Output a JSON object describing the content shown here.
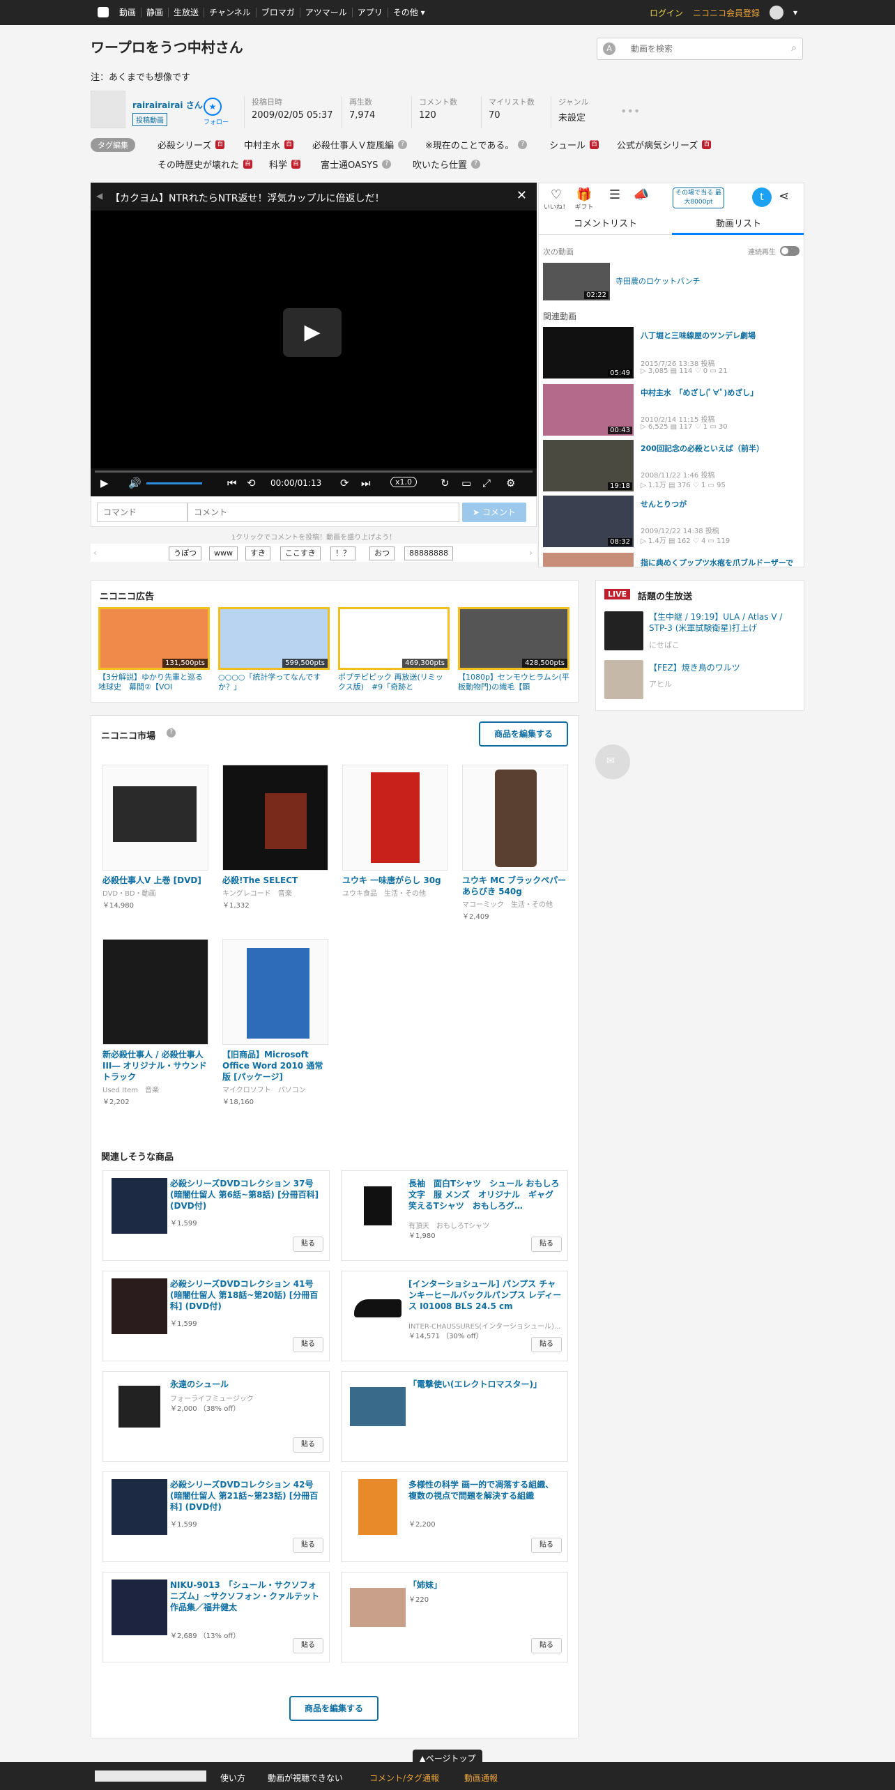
{
  "topnav": {
    "items": [
      "動画",
      "静画",
      "生放送",
      "チャンネル",
      "ブロマガ",
      "アツマール",
      "アプリ",
      "その他"
    ],
    "login": "ログイン",
    "register": "ニコニコ会員登録"
  },
  "header": {
    "title": "ワープロをうつ中村さん",
    "subtitle": "注：あくまでも想像です",
    "search_placeholder": "動画を検索"
  },
  "uploader": {
    "name": "rairairairai さん",
    "badge": "投稿動画",
    "follow": "フォロー"
  },
  "stats": [
    {
      "k": "投稿日時",
      "v": "2009/02/05 05:37"
    },
    {
      "k": "再生数",
      "v": "7,974"
    },
    {
      "k": "コメント数",
      "v": "120"
    },
    {
      "k": "マイリスト数",
      "v": "70"
    },
    {
      "k": "ジャンル",
      "v": "未設定"
    }
  ],
  "tags": {
    "edit_label": "タグ編集",
    "items": [
      "必殺シリーズ",
      "中村主水",
      "必殺仕事人Ｖ旋風編",
      "※現在のことである。",
      "シュール",
      "公式が病気シリーズ",
      "その時歴史が壊れた",
      "科学",
      "富士通OASYS",
      "吹いたら仕置"
    ]
  },
  "player": {
    "title": "【カクヨム】NTRれたらNTR返せ！浮気カップルに倍返しだ！",
    "time": "00:00/01:13",
    "speed": "x1.0",
    "command_placeholder": "コマンド",
    "comment_placeholder": "コメント",
    "send": "コメント",
    "hint": "1クリックでコメントを投稿！動画を盛り上げよう！",
    "quick": [
      "うぽつ",
      "www",
      "すき",
      "ここすき",
      "！？",
      "おつ",
      "88888888"
    ]
  },
  "side": {
    "icons": [
      "いいね！",
      "ギフト",
      "",
      "",
      ""
    ],
    "campaign": "その場で当る 最大8000pt",
    "tab_comments": "コメントリスト",
    "tab_videos": "動画リスト",
    "next_label": "次の動画",
    "autoplay": "連続再生",
    "next_video": {
      "title": "寺田農のロケットパンチ",
      "duration": "02:22"
    },
    "related_label": "関連動画",
    "related": [
      {
        "title": "八丁堀と三味線屋のツンデレ劇場",
        "date": "2015/7/26 13:38 投稿",
        "stats": "▷ 3,085 ▤ 114 ♡ 0 ▭ 21",
        "duration": "05:49"
      },
      {
        "title": "中村主水　「めざし(ﾟ∀ﾟ)めざし」",
        "date": "2010/2/14 11:15 投稿",
        "stats": "▷ 6,525 ▤ 117 ♡ 1 ▭ 30",
        "duration": "00:43"
      },
      {
        "title": "200回記念の必殺といえば（前半）",
        "date": "2008/11/22 1:46 投稿",
        "stats": "▷ 1.1万 ▤ 376 ♡ 1 ▭ 95",
        "duration": "19:18"
      },
      {
        "title": "せんとりつが",
        "date": "2009/12/22 14:38 投稿",
        "stats": "▷ 1.4万 ▤ 162 ♡ 4 ▭ 119",
        "duration": "08:32"
      },
      {
        "title": "指に典めくプップツ水疱を爪ブルドーザーで",
        "date": "",
        "stats": "",
        "duration": ""
      }
    ]
  },
  "ads": {
    "heading": "ニコニコ広告",
    "items": [
      {
        "text": "【3分解説】ゆかり先輩と巡る地球史　幕間②【VOI",
        "pts": "131,500pts"
      },
      {
        "text": "○○○○「統計学ってなんですか？」",
        "pts": "599,500pts"
      },
      {
        "text": "ポプテピピック 再放送(リミックス版)　#9「奇跡と",
        "pts": "469,300pts"
      },
      {
        "text": "【1080p】センモウヒラムシ(平板動物門)の繊毛【顕",
        "pts": "428,500pts"
      }
    ]
  },
  "live": {
    "badge": "LIVE",
    "heading": "話題の生放送",
    "items": [
      {
        "title": "【生中継 / 19:19】ULA / Atlas V / STP-3 (米軍試験衛星)打上げ",
        "ch": "にせばこ"
      },
      {
        "title": "【FEZ】焼き鳥のワルツ",
        "ch": "アヒル"
      }
    ]
  },
  "market": {
    "heading": "ニコニコ市場",
    "edit": "商品を編集する",
    "items": [
      {
        "title": "必殺仕事人V 上巻 [DVD]",
        "sub": "DVD・BD・動画",
        "price": "￥14,980"
      },
      {
        "title": "必殺!The SELECT",
        "sub": "キングレコード　音楽",
        "price": "￥1,332"
      },
      {
        "title": "ユウキ 一味唐がらし 30g",
        "sub": "ユウキ食品　生活・その他",
        "price": ""
      },
      {
        "title": "ユウキ MC ブラックペパーあらびき 540g",
        "sub": "マコーミック　生活・その他",
        "price": "￥2,409"
      },
      {
        "title": "新必殺仕事人 / 必殺仕事人 III― オリジナル・サウンドトラック",
        "sub": "Used Item　音楽",
        "price": "￥2,202"
      },
      {
        "title": "【旧商品】Microsoft Office Word 2010 通常版 [パッケージ]",
        "sub": "マイクロソフト　パソコン",
        "price": "￥18,160"
      }
    ],
    "related_heading": "関連しそうな商品",
    "related": [
      {
        "title": "必殺シリーズDVDコレクション 37号 (暗闇仕留人 第6話~第8話) [分冊百科] (DVD付)",
        "sub": "",
        "price": "￥1,599"
      },
      {
        "title": "長袖　面白Tシャツ　シュール おもしろ文字　服 メンズ　オリジナル　ギャグ　笑えるTシャツ　おもしろグ…",
        "sub": "有頂天　おもしろTシャツ",
        "price": "￥1,980"
      },
      {
        "title": "必殺シリーズDVDコレクション 41号 (暗闇仕留人 第18話~第20話) [分冊百科] (DVD付)",
        "sub": "",
        "price": "￥1,599"
      },
      {
        "title": "[インターショシュール] パンプス チャンキーヒールバックルパンプス レディース I01008 BLS 24.5 cm",
        "sub": "INTER-CHAUSSURES(インターショシュール)...",
        "price": "￥14,571 （30% off）"
      },
      {
        "title": "永遠のシュール",
        "sub": "フォーライフミュージック",
        "price": "￥2,000 （38% off）"
      },
      {
        "title": "「電撃使い(エレクトロマスター)」",
        "sub": "",
        "price": ""
      },
      {
        "title": "必殺シリーズDVDコレクション 42号 (暗闇仕留人 第21話~第23話) [分冊百科] (DVD付)",
        "sub": "",
        "price": "￥1,599"
      },
      {
        "title": "多様性の科学 画一的で凋落する組織、複数の視点で問題を解決する組織",
        "sub": "",
        "price": "￥2,200"
      },
      {
        "title": "NIKU-9013　「シュール・サクソフォニズム」~サクソフォン・クァルテット作品集／福井健太",
        "sub": "",
        "price": "￥2,689 （13% off）"
      },
      {
        "title": "「姉妹」",
        "sub": "",
        "price": "￥220"
      }
    ],
    "paste": "貼る"
  },
  "pagetop": "▲ページトップ",
  "footer": [
    "使い方",
    "動画が視聴できない",
    "コメント/タグ通報",
    "動画通報"
  ]
}
